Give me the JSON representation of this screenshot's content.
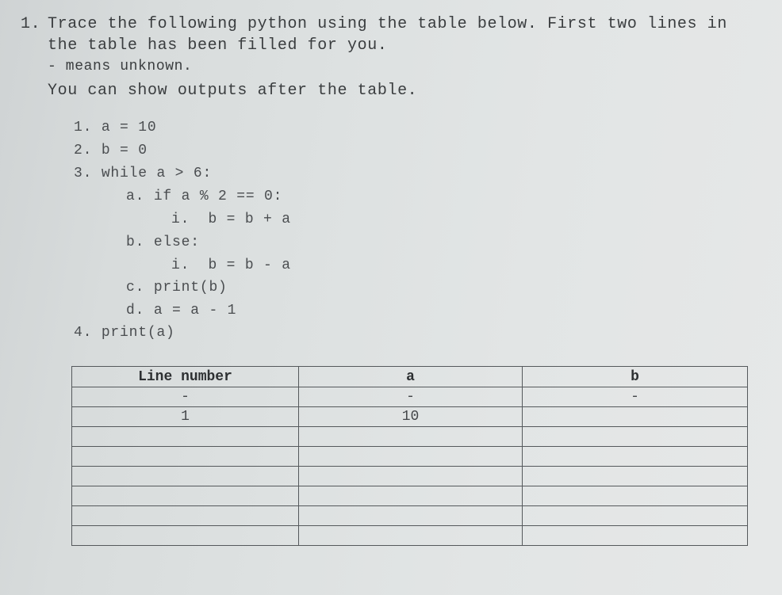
{
  "question": {
    "number": "1.",
    "lines": [
      "Trace the following python using the table below. First two lines in",
      "the table has been filled for you.",
      "- means unknown.",
      "You can show outputs after the table."
    ]
  },
  "code": [
    {
      "label": "1.",
      "text": "a = 10"
    },
    {
      "label": "2.",
      "text": "b = 0"
    },
    {
      "label": "3.",
      "text": "while a > 6:"
    },
    {
      "label": "a.",
      "text": "if a % 2 == 0:"
    },
    {
      "label": "i.",
      "text": "b = b + a"
    },
    {
      "label": "b.",
      "text": "else:"
    },
    {
      "label": "i.",
      "text": "b = b - a"
    },
    {
      "label": "c.",
      "text": "print(b)"
    },
    {
      "label": "d.",
      "text": "a = a - 1"
    },
    {
      "label": "4.",
      "text": "print(a)"
    }
  ],
  "table": {
    "headers": [
      "Line number",
      "a",
      "b"
    ],
    "rows": [
      [
        "-",
        "-",
        "-"
      ],
      [
        "1",
        "10",
        ""
      ],
      [
        "",
        "",
        ""
      ],
      [
        "",
        "",
        ""
      ],
      [
        "",
        "",
        ""
      ],
      [
        "",
        "",
        ""
      ],
      [
        "",
        "",
        ""
      ],
      [
        "",
        "",
        ""
      ]
    ]
  }
}
